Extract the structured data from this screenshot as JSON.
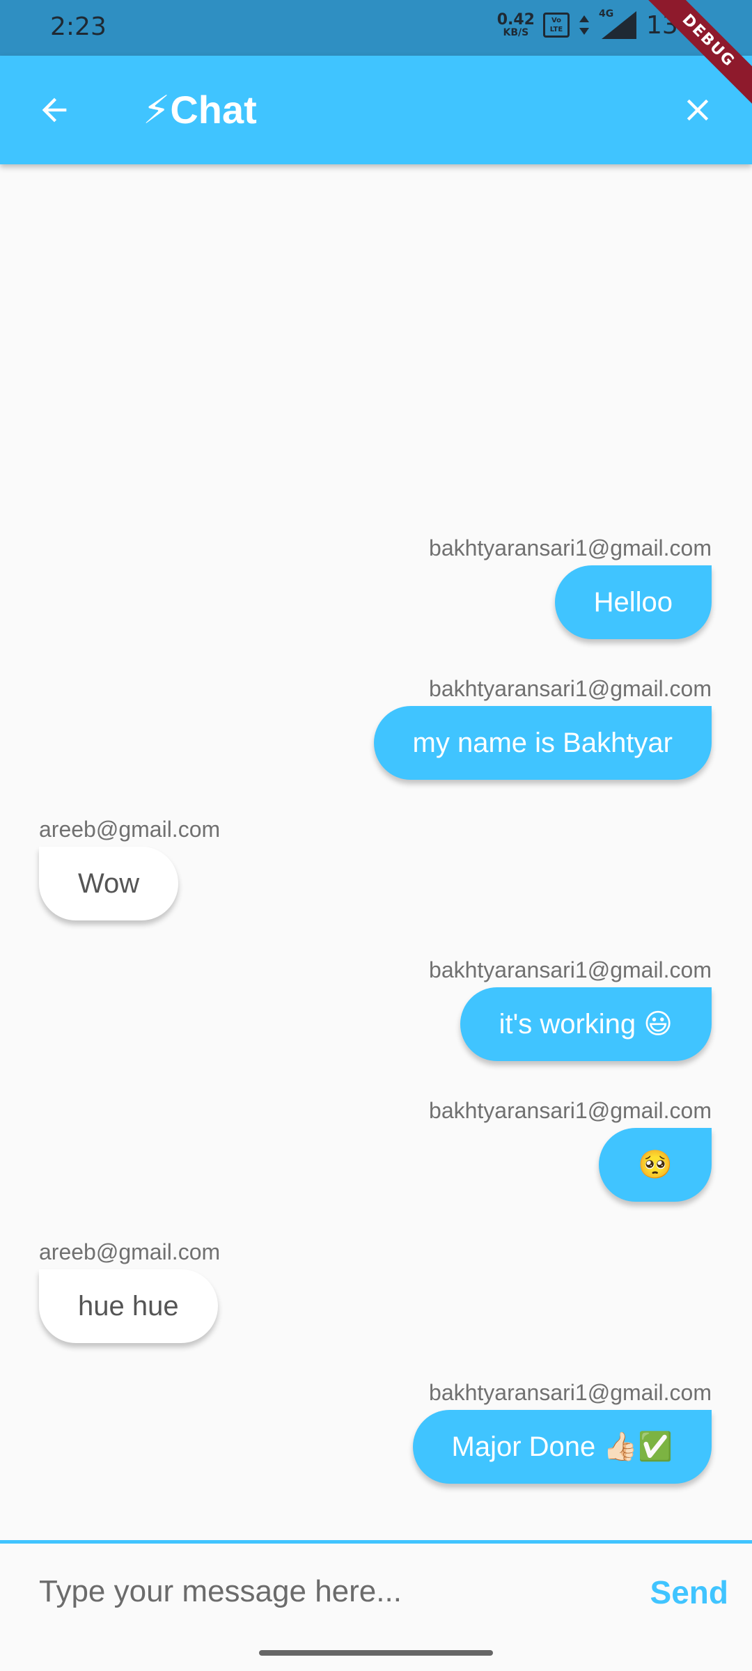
{
  "status_bar": {
    "time": "2:23",
    "net_speed_value": "0.42",
    "net_speed_unit": "KB/S",
    "volte_label": "Vo LTE",
    "network_type": "4G",
    "battery_percent": "13%"
  },
  "debug_banner": "DEBUG",
  "app_bar": {
    "title_icon": "⚡",
    "title": "Chat",
    "back_icon": "arrow-left-icon",
    "close_icon": "close-icon"
  },
  "messages": [
    {
      "sender": "bakhtyaransari1@gmail.com",
      "text": "Helloo",
      "is_me": true
    },
    {
      "sender": "bakhtyaransari1@gmail.com",
      "text": "my name is Bakhtyar",
      "is_me": true
    },
    {
      "sender": "areeb@gmail.com",
      "text": "Wow",
      "is_me": false
    },
    {
      "sender": "bakhtyaransari1@gmail.com",
      "text": "it's working 😃",
      "is_me": true
    },
    {
      "sender": "bakhtyaransari1@gmail.com",
      "text": "🥺",
      "is_me": true
    },
    {
      "sender": "areeb@gmail.com",
      "text": "hue hue",
      "is_me": false
    },
    {
      "sender": "bakhtyaransari1@gmail.com",
      "text": "Major Done 👍🏻✅",
      "is_me": true
    }
  ],
  "input": {
    "placeholder": "Type your message here...",
    "value": "",
    "send_label": "Send"
  },
  "colors": {
    "accent": "#40c4ff",
    "status_bar": "#2f8fc2",
    "background": "#fafafa",
    "debug_banner": "#8e1a2c"
  }
}
